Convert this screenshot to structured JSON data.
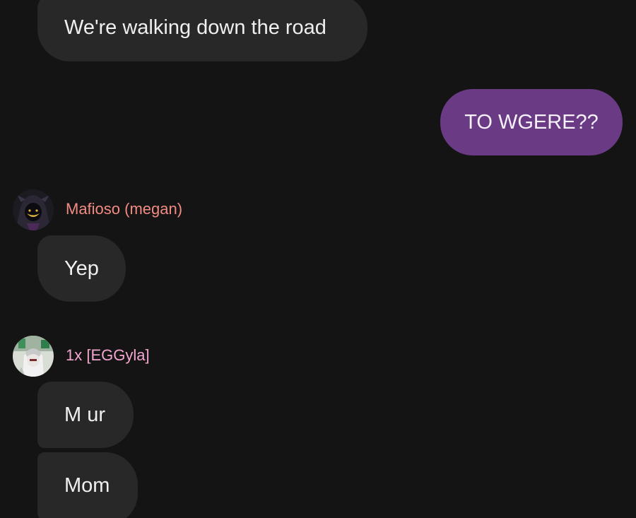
{
  "conversation": {
    "messages": [
      {
        "text": "We're walking down the road"
      },
      {
        "text": "TO WGERE??"
      },
      {
        "text": "Yep"
      },
      {
        "text": "M ur"
      },
      {
        "text": "Mom"
      }
    ],
    "senders": [
      {
        "name": "Mafioso (megan)",
        "color": "#f28b82"
      },
      {
        "name": "1x [EGGyla]",
        "color": "#f3a6cf"
      }
    ]
  },
  "colors": {
    "background": "#141414",
    "incoming_bubble": "#282828",
    "outgoing_bubble": "#6a3a85"
  },
  "icons": {
    "avatar_1": "dark-hooded-character-avatar",
    "avatar_2": "green-white-character-avatar"
  }
}
